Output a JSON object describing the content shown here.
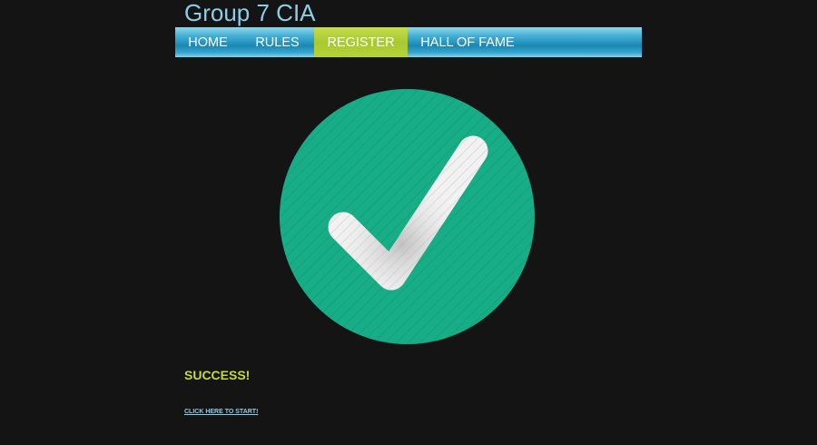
{
  "header": {
    "site_title": "Group 7 CIA"
  },
  "nav": {
    "items": [
      {
        "label": "HOME",
        "active": false
      },
      {
        "label": "RULES",
        "active": false
      },
      {
        "label": "REGISTER",
        "active": true
      },
      {
        "label": "HALL OF FAME",
        "active": false
      }
    ],
    "active_color": "#a8c92d",
    "bar_color": "#1a87b3"
  },
  "main": {
    "status_icon": "checkmark-circle-icon",
    "status_icon_color": "#17ae87",
    "message": "SUCCESS!",
    "message_color": "#c3dc3a",
    "start_link_label": "CLICK HERE TO START!"
  }
}
